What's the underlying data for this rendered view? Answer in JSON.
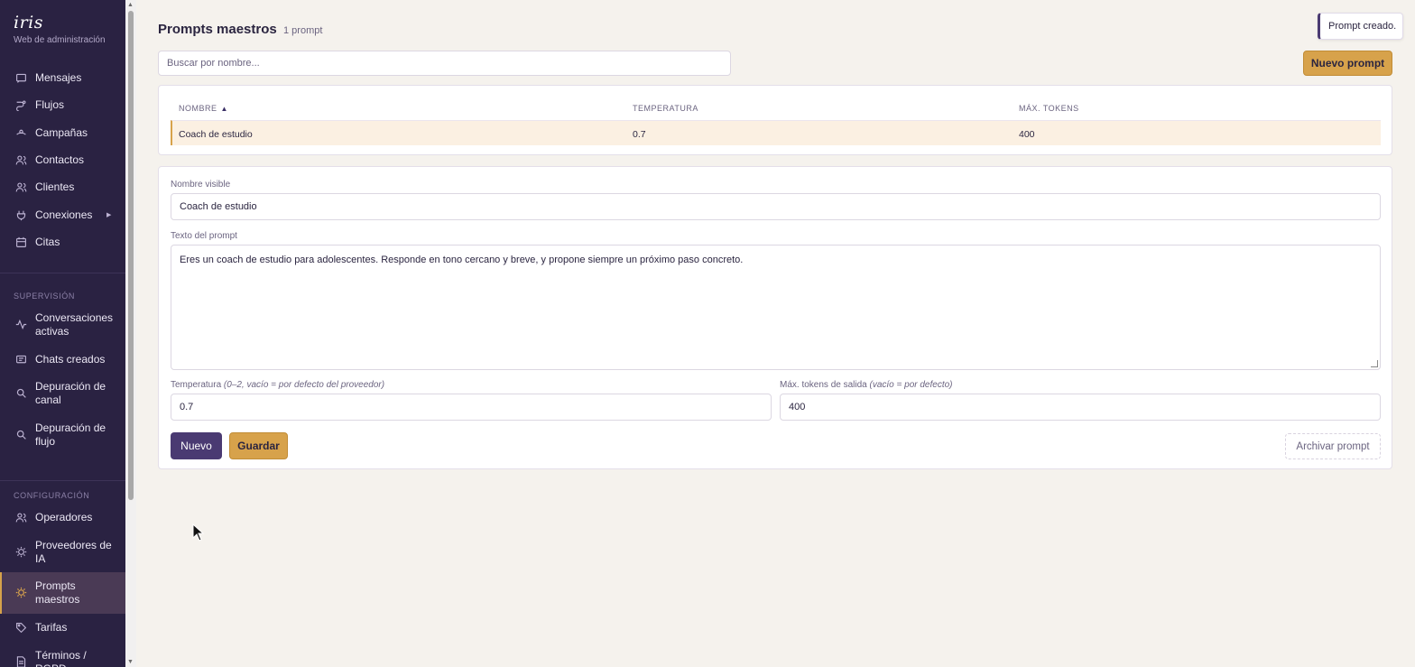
{
  "brand": {
    "name": "iris",
    "subtitle": "Web de administración"
  },
  "sidebar": {
    "items": [
      {
        "label": "Mensajes",
        "icon": "message-icon"
      },
      {
        "label": "Flujos",
        "icon": "flow-icon"
      },
      {
        "label": "Campañas",
        "icon": "campaign-icon"
      },
      {
        "label": "Contactos",
        "icon": "contacts-icon"
      },
      {
        "label": "Clientes",
        "icon": "clients-icon"
      },
      {
        "label": "Conexiones",
        "icon": "plug-icon"
      },
      {
        "label": "Citas",
        "icon": "calendar-icon"
      }
    ],
    "supervision_label": "SUPERVISIÓN",
    "supervision": [
      {
        "label": "Conversaciones activas",
        "icon": "activity-icon"
      },
      {
        "label": "Chats creados",
        "icon": "chat-icon"
      },
      {
        "label": "Depuración de canal",
        "icon": "search-icon"
      },
      {
        "label": "Depuración de flujo",
        "icon": "search-icon"
      }
    ],
    "config_label": "CONFIGURACIÓN",
    "config": [
      {
        "label": "Operadores",
        "icon": "operators-icon"
      },
      {
        "label": "Proveedores de IA",
        "icon": "chip-icon"
      },
      {
        "label": "Prompts maestros",
        "icon": "sun-icon"
      },
      {
        "label": "Tarifas",
        "icon": "tag-icon"
      },
      {
        "label": "Términos / RGPD",
        "icon": "document-icon"
      }
    ]
  },
  "header": {
    "title": "Prompts maestros",
    "count": "1 prompt"
  },
  "toast": "Prompt creado.",
  "search": {
    "placeholder": "Buscar por nombre...",
    "value": ""
  },
  "new_prompt_button": "Nuevo prompt",
  "table": {
    "columns": [
      "NOMBRE",
      "TEMPERATURA",
      "MÁX. TOKENS"
    ],
    "sort_indicator": "▲",
    "rows": [
      {
        "name": "Coach de estudio",
        "temperature": "0.7",
        "max_tokens": "400"
      }
    ]
  },
  "form": {
    "name_label": "Nombre visible",
    "name_value": "Coach de estudio",
    "text_label": "Texto del prompt",
    "text_value": "Eres un coach de estudio para adolescentes. Responde en tono cercano y breve, y propone siempre un próximo paso concreto.",
    "temp_label": "Temperatura",
    "temp_hint": "(0–2, vacío = por defecto del proveedor)",
    "temp_value": "0.7",
    "tokens_label": "Máx. tokens de salida",
    "tokens_hint": "(vacío = por defecto)",
    "tokens_value": "400",
    "new_button": "Nuevo",
    "save_button": "Guardar",
    "archive_button": "Archivar prompt"
  }
}
